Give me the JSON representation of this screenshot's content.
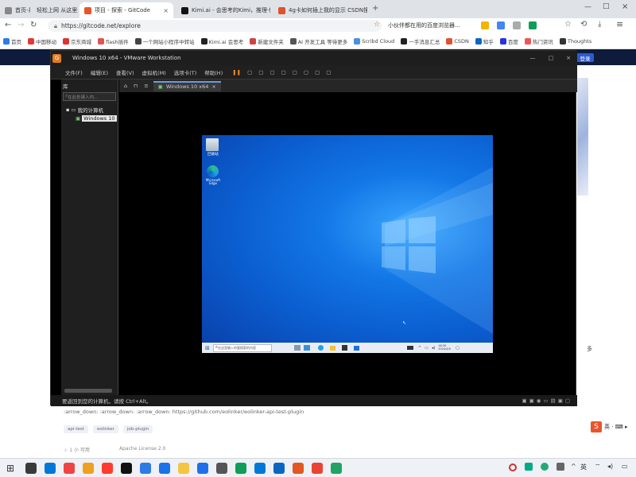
{
  "browser": {
    "tabs": [
      {
        "label": "首页-易",
        "color": "#888"
      },
      {
        "label": "轻松上网 从这里开始",
        "color": "#3a7bd5"
      },
      {
        "label": "项目 - 探索 - GitCode",
        "color": "#e8552c",
        "active": true
      },
      {
        "label": "Kimi.ai - 会思考的Kimi，推理·做…",
        "color": "#111"
      },
      {
        "label": "4g卡如何插上我的显示 CSDN搜",
        "color": "#e0522b"
      }
    ],
    "url": "https://gitcode.net/explore",
    "toolbar_right_text": "小伙伴都在用的百度浏览器…",
    "bookmarks": [
      {
        "label": "首页",
        "color": "#2d7be5"
      },
      {
        "label": "中国移动",
        "color": "#e23a3a"
      },
      {
        "label": "京东商城",
        "color": "#d33"
      },
      {
        "label": "flash插件",
        "color": "#d55"
      },
      {
        "label": "一个网站小程序中转站",
        "color": "#444"
      },
      {
        "label": "Kimi.ai 会思考",
        "color": "#222"
      },
      {
        "label": "新建文件夹",
        "color": "#c44"
      },
      {
        "label": "AI 开发工具 等待更多",
        "color": "#555"
      },
      {
        "label": "Scribd Cloud",
        "color": "#4a90e2"
      },
      {
        "label": "一手消息汇总",
        "color": "#222"
      },
      {
        "label": "CSDN",
        "color": "#e0522b"
      },
      {
        "label": "知乎",
        "color": "#0a66c2"
      },
      {
        "label": "百度",
        "color": "#2932e1"
      },
      {
        "label": "热门资讯",
        "color": "#e55"
      },
      {
        "label": "Thoughts",
        "color": "#333"
      }
    ]
  },
  "page": {
    "login_button": "登录",
    "tags_text": ":arrow_down: :arrow_down: :arrow_down: https://github.com/eolinker/eolinker-api-test-plugin",
    "tags": [
      "api-test",
      "eolinker",
      "job-plugin"
    ],
    "stars": "☆ 1 小 可用",
    "license": "Apache License 2.0",
    "right_text": "多"
  },
  "vmware": {
    "title": "Windows 10 x64 - VMware Workstation",
    "menu": [
      "文件(F)",
      "编辑(E)",
      "查看(V)",
      "虚拟机(M)",
      "选项卡(T)",
      "帮助(H)"
    ],
    "library_label": "库",
    "search_placeholder": "在此处键入内…",
    "tree_root": "我的计算机",
    "tree_child": "Windows 10",
    "tab_label": "Windows 10 x64",
    "status": "要返回到您的计算机，请按 Ctrl+Alt。",
    "guest": {
      "icon1": "回收站",
      "icon2": "Microsoft Edge",
      "search_text": "在这里输入你要搜索的内容",
      "clock": "16:30\n2024/4/5"
    }
  },
  "taskbar_icons": [
    "#3a3a3a",
    "#0078d7",
    "#e44",
    "#f0a020",
    "#ff3b30",
    "#111",
    "#2d7be5",
    "#1a73e8",
    "#f4c542",
    "#1f6feb",
    "#555",
    "#0f9d58",
    "#0078d7",
    "#0a66c2",
    "#e25822",
    "#ea4335",
    "#21a366"
  ]
}
